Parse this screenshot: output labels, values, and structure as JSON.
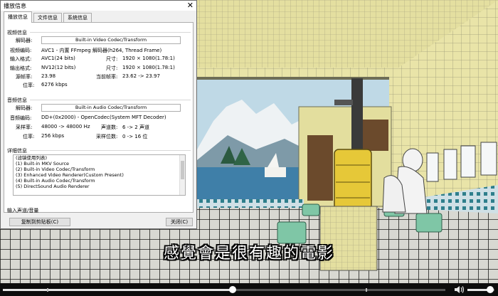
{
  "subtitle": "感覺會是很有趣的電影",
  "dialog": {
    "title": "播放信息",
    "close_glyph": "✕",
    "tabs": [
      "播放信息",
      "文件信息",
      "系统信息"
    ],
    "video": {
      "section": "视频信息",
      "decoder_label": "解码器:",
      "decoder_value": "Built-in Video Codec/Transform",
      "codec_label": "视频编码:",
      "codec_value": "AVC1 - 内置 FFmpeg 解码器(h264, Thread Frame)",
      "input_format_label": "输入格式:",
      "input_format_value": "AVC1(24 bits)",
      "size_label_1": "尺寸:",
      "size_value_1": "1920 × 1080(1.78:1)",
      "output_format_label": "输出格式:",
      "output_format_value": "NV12(12 bits)",
      "size_label_2": "尺寸:",
      "size_value_2": "1920 × 1080(1.78:1)",
      "source_fps_label": "源帧率:",
      "source_fps_value": "23.98",
      "current_fps_label": "当前帧率:",
      "current_fps_value": "23.62 -> 23.97",
      "bitrate_label": "位率:",
      "bitrate_value": "6276 kbps"
    },
    "audio": {
      "section": "音频信息",
      "decoder_label": "解码器:",
      "decoder_value": "Built-in Audio Codec/Transform",
      "codec_label": "音频编码:",
      "codec_value": "DD+(0x2000) - OpenCodec(System MFT Decoder)",
      "samplerate_label": "采样率:",
      "samplerate_value": "48000 -> 48000 Hz",
      "channels_label": "声道数:",
      "channels_value": "6 -> 2 声道",
      "bitrate_label": "位率:",
      "bitrate_value": "256 kbps",
      "bits_label": "采样位数:",
      "bits_value": "0 -> 16 位"
    },
    "detail": {
      "section": "详细信息",
      "lines": [
        "(滤镜使用列表)",
        "(1) Built-in MKV Source",
        "(2) Built-in Video Codec/Transform",
        "(3) Enhanced Video Renderer(Custom Present)",
        "(4) Built-in Audio Codec/Transform",
        "(5) DirectSound Audio Renderer"
      ]
    },
    "input_channel_label": "输入声道/音量",
    "copy_button": "复制到剪贴板(C)",
    "close_button": "关闭(C)"
  },
  "player": {
    "seek_progress": 0.52,
    "volume_level": 0.85
  },
  "colors": {
    "wall_tile": "#e9e4a8",
    "floor_grid": "#2a2a28",
    "sea": "#3f7fa8",
    "tub": "#e6c838"
  }
}
